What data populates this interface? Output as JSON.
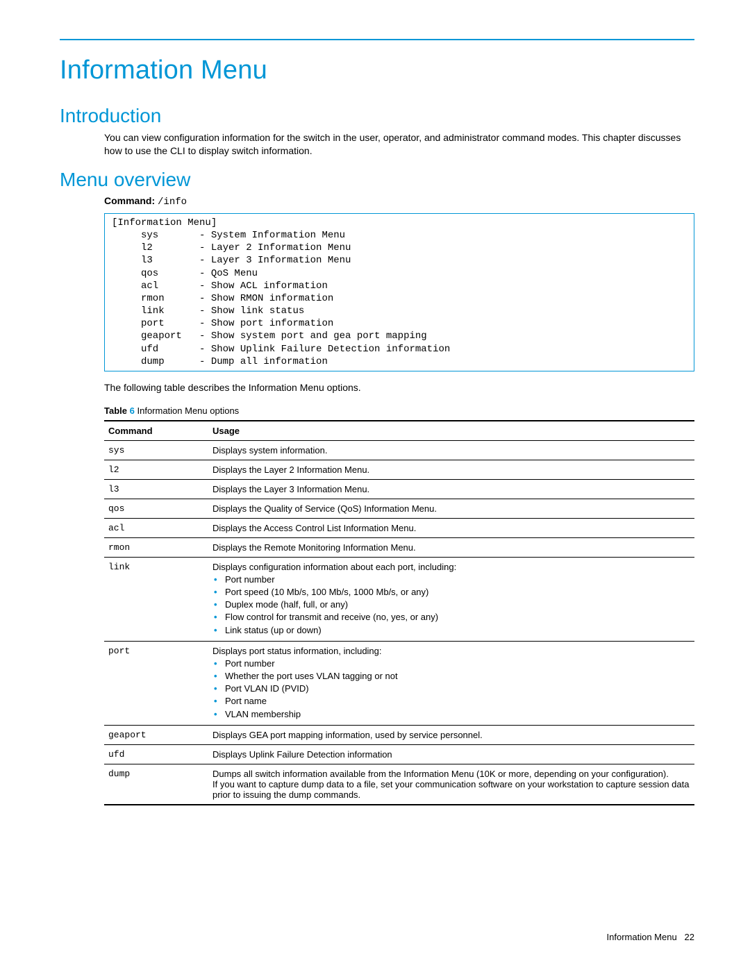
{
  "title": "Information Menu",
  "introduction": {
    "heading": "Introduction",
    "text": "You can view configuration information for the switch in the user, operator, and administrator command modes. This chapter discusses how to use the CLI to display switch information."
  },
  "overview": {
    "heading": "Menu overview",
    "command_label": "Command:",
    "command_value": "/info",
    "terminal": "[Information Menu]\n     sys       - System Information Menu\n     l2        - Layer 2 Information Menu\n     l3        - Layer 3 Information Menu\n     qos       - QoS Menu\n     acl       - Show ACL information\n     rmon      - Show RMON information\n     link      - Show link status\n     port      - Show port information\n     geaport   - Show system port and gea port mapping\n     ufd       - Show Uplink Failure Detection information\n     dump      - Dump all information",
    "post_text": "The following table describes the Information Menu options."
  },
  "table": {
    "caption_prefix": "Table",
    "caption_num": "6",
    "caption_text": "Information Menu options",
    "headers": {
      "col1": "Command",
      "col2": "Usage"
    },
    "rows": [
      {
        "cmd": "sys",
        "usage": "Displays system information."
      },
      {
        "cmd": "l2",
        "usage": "Displays the Layer 2 Information Menu."
      },
      {
        "cmd": "l3",
        "usage": "Displays the Layer 3 Information Menu."
      },
      {
        "cmd": "qos",
        "usage": "Displays the Quality of Service (QoS) Information Menu."
      },
      {
        "cmd": "acl",
        "usage": "Displays the Access Control List Information Menu."
      },
      {
        "cmd": "rmon",
        "usage": "Displays the Remote Monitoring Information Menu."
      },
      {
        "cmd": "link",
        "usage_pre": "Displays configuration information about each port, including:",
        "bullets": [
          "Port number",
          "Port speed (10 Mb/s, 100 Mb/s, 1000 Mb/s, or any)",
          "Duplex mode (half, full, or any)",
          "Flow control for transmit and receive (no, yes, or any)",
          "Link status (up or down)"
        ]
      },
      {
        "cmd": "port",
        "usage_pre": "Displays port status information, including:",
        "bullets": [
          "Port number",
          "Whether the port uses VLAN tagging or not",
          "Port VLAN ID (PVID)",
          "Port name",
          "VLAN membership"
        ]
      },
      {
        "cmd": "geaport",
        "usage": "Displays GEA port mapping information, used by service personnel."
      },
      {
        "cmd": "ufd",
        "usage": "Displays Uplink Failure Detection information"
      },
      {
        "cmd": "dump",
        "usage": "Dumps all switch information available from the Information Menu (10K or more, depending on your configuration).\nIf you want to capture dump data to a file, set your communication software on your workstation to capture session data prior to issuing the dump commands."
      }
    ]
  },
  "footer": {
    "label": "Information Menu",
    "page": "22"
  }
}
